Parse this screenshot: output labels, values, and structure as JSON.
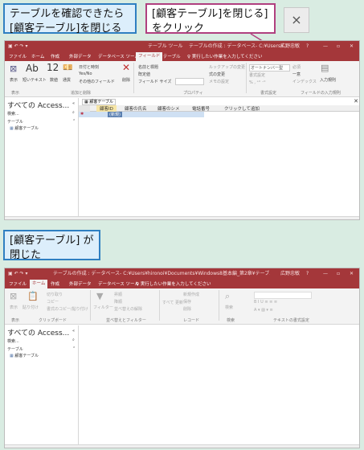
{
  "callout1": {
    "line1": "テーブルを確認できたら",
    "line2": "[顧客テーブル]を閉じる"
  },
  "callout2": {
    "line1": "[顧客テーブル]を閉じる]",
    "line2": "をクリック"
  },
  "close_symbol": "×",
  "callout3": {
    "line1": "[顧客テーブル] が",
    "line2": "閉じた"
  },
  "window1": {
    "context_tab": "テーブル ツール",
    "title": "テーブルの作成 : データベース- C:¥Users¥...",
    "user": "広野忠敏",
    "menu_tabs": [
      "ファイル",
      "ホーム",
      "作成",
      "外部データ",
      "データベース ツール",
      "フィールド",
      "テーブル"
    ],
    "tellme": "実行したい作業を入力してください",
    "ribbon": {
      "view": "表示",
      "short_text": "短いテキスト",
      "number": "12",
      "num_label": "数値",
      "currency": "通貨",
      "date_time": "日付と時刻",
      "yes_no": "Yes/No",
      "other_fields": "その他のフィールド",
      "delete": "削除",
      "name_caption": "名前と標題",
      "default_value": "既定値",
      "field_size": "フィールド サイズ",
      "lookup": "ルックアップの変更",
      "expression": "式の変更",
      "memo": "メモの設定",
      "data_type": "オートナンバー型",
      "format": "書式設定",
      "required": "必須",
      "unique": "一意",
      "indexed": "インデックス",
      "validation": "入力規則",
      "groups": [
        "表示",
        "追加と削除",
        "プロパティ",
        "書式設定",
        "フィールドの入力規則"
      ]
    },
    "nav": {
      "title": "すべての Access...",
      "search": "検索...",
      "section": "テーブル",
      "item": "顧客テーブル"
    },
    "doc_tab": "顧客テーブル",
    "columns": [
      "顧客ID",
      "顧客の氏名",
      "顧客のシメ",
      "電話番号",
      "クリックして追加"
    ],
    "new_row": "(新規)"
  },
  "window2": {
    "title": "テーブルの作成 : データベース- C:¥Users¥hironoi¥Documents¥Windows8基本編_第2章¥テーブルの作成.accdb (Acce",
    "user": "広野忠敏",
    "menu_tabs": [
      "ファイル",
      "ホーム",
      "作成",
      "外部データ",
      "データベース ツール"
    ],
    "tellme": "実行したい作業を入力してください",
    "ribbon": {
      "view": "表示",
      "paste": "貼り付け",
      "cut": "切り取り",
      "copy": "コピー",
      "format_painter": "書式のコピー/貼り付け",
      "filter": "フィルター",
      "ascending": "昇順",
      "descending": "降順",
      "remove_sort": "並べ替えの解除",
      "refresh": "すべて 更新",
      "new": "新規作成",
      "save": "保存",
      "delete": "削除",
      "find": "検索",
      "groups": [
        "表示",
        "クリップボード",
        "並べ替えとフィルター",
        "レコード",
        "検索",
        "テキストの書式設定"
      ]
    },
    "nav": {
      "title": "すべての Access...",
      "search": "検索...",
      "section": "テーブル",
      "item": "顧客テーブル"
    }
  }
}
